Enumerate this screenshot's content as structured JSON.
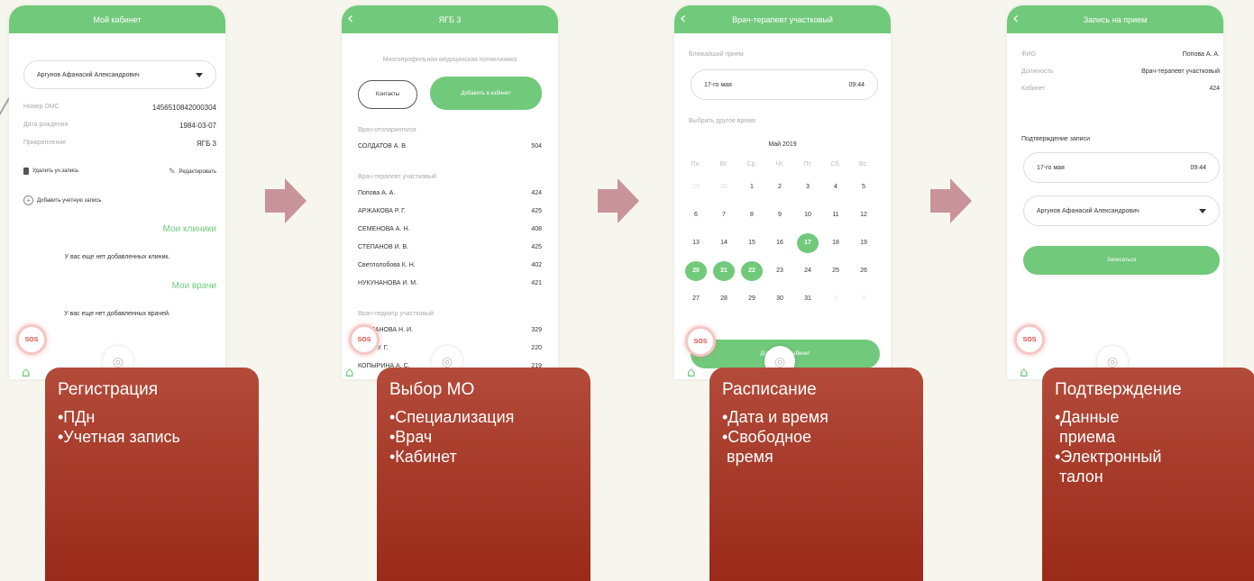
{
  "screen1": {
    "title": "Мой кабинет",
    "user_name": "Аргунов Афанасий Александрович",
    "fields": [
      {
        "label": "Номер ОМС",
        "value": "1456510842000304"
      },
      {
        "label": "Дата рождения",
        "value": "1984-03-07"
      },
      {
        "label": "Прикрепление",
        "value": "ЯГБ 3"
      }
    ],
    "delete_label": "Удалить уч.запись",
    "edit_label": "Редактировать",
    "add_account_label": "Добавить учетную запись",
    "my_clinics": "Мои клиники",
    "no_clinics": "У вас еще нет добавленных клиник.",
    "my_doctors": "Мои врачи",
    "no_doctors": "У вас еще нет добавленных врачей.",
    "sos": "SOS"
  },
  "screen2": {
    "title": "ЯГБ 3",
    "subtitle": "Многопрофильная медицинская поликлиника",
    "contacts_button": "Контакты",
    "add_button": "Добавить в кабинет",
    "sections": [
      {
        "specialty": "Врач-отоларинголог",
        "doctors": [
          {
            "name": "СОЛДАТОВ А. В.",
            "room": "504"
          }
        ]
      },
      {
        "specialty": "Врач-терапевт участковый",
        "doctors": [
          {
            "name": "Попова А. А.",
            "room": "424"
          },
          {
            "name": "АРЖАКОВА Р. Г.",
            "room": "425"
          },
          {
            "name": "СЕМЕНОВА А. Н.",
            "room": "408"
          },
          {
            "name": "СТЕПАНОВ И. В.",
            "room": "425"
          },
          {
            "name": "Светлолобова К. Н.",
            "room": "402"
          },
          {
            "name": "НУКУНАНОВА И. М.",
            "room": "421"
          }
        ]
      },
      {
        "specialty": "Врач-педиатр участковый",
        "doctors": [
          {
            "name": "СТЕПАНОВА Н. И.",
            "room": "329"
          },
          {
            "name": "СОВА У. Г.",
            "room": "220"
          },
          {
            "name": "КОПЫРИНА А. С.",
            "room": "219"
          }
        ]
      }
    ],
    "sos": "SOS"
  },
  "screen3": {
    "title": "Врач-терапевт участковый",
    "nearest_label": "Ближайший прием",
    "nearest_date": "17-го мая",
    "nearest_time": "09:44",
    "other_time_label": "Выбрать другое время",
    "month": "Май 2019",
    "weekdays": [
      "Пн.",
      "Вт.",
      "Ср.",
      "Чт.",
      "Пт.",
      "Сб.",
      "Вс."
    ],
    "days": [
      [
        "29",
        "30",
        "1",
        "2",
        "3",
        "4",
        "5"
      ],
      [
        "6",
        "7",
        "8",
        "9",
        "10",
        "11",
        "12"
      ],
      [
        "13",
        "14",
        "15",
        "16",
        "17",
        "18",
        "19"
      ],
      [
        "20",
        "21",
        "22",
        "23",
        "24",
        "25",
        "26"
      ],
      [
        "27",
        "28",
        "29",
        "30",
        "31",
        "1",
        "2"
      ]
    ],
    "dim_days": [
      [
        0,
        0
      ],
      [
        0,
        1
      ],
      [
        4,
        5
      ],
      [
        4,
        6
      ]
    ],
    "selected_days": [
      [
        2,
        4
      ],
      [
        3,
        0
      ],
      [
        3,
        1
      ],
      [
        3,
        2
      ]
    ],
    "bottom_button": "Добавить в кабинет",
    "sos": "SOS"
  },
  "screen4": {
    "title": "Запись на прием",
    "fields": [
      {
        "label": "ФИО",
        "value": "Попова А. А."
      },
      {
        "label": "Должность",
        "value": "Врач-терапевт участковый"
      },
      {
        "label": "Кабинет",
        "value": "424"
      }
    ],
    "confirm_label": "Подтверждение записи",
    "date": "17-го мая",
    "time": "09:44",
    "patient": "Аргунов Афанасий Александрович",
    "submit_button": "Записаться",
    "sos": "SOS"
  },
  "cards": [
    {
      "title": "Регистрация",
      "bullets": [
        "•ПДн",
        "•Учетная запись"
      ]
    },
    {
      "title": "Выбор МО",
      "bullets": [
        "•Специализация",
        "•Врач",
        "•Кабинет"
      ]
    },
    {
      "title": "Расписание",
      "bullets": [
        "•Дата и время",
        "•Свободное",
        " время"
      ]
    },
    {
      "title": "Подтверждение",
      "bullets": [
        "•Данные",
        " приема",
        "•Электронный",
        " талон"
      ]
    }
  ],
  "colors": {
    "accent": "#71c97b",
    "card": "#a8382a",
    "arrow": "#c8949a"
  }
}
